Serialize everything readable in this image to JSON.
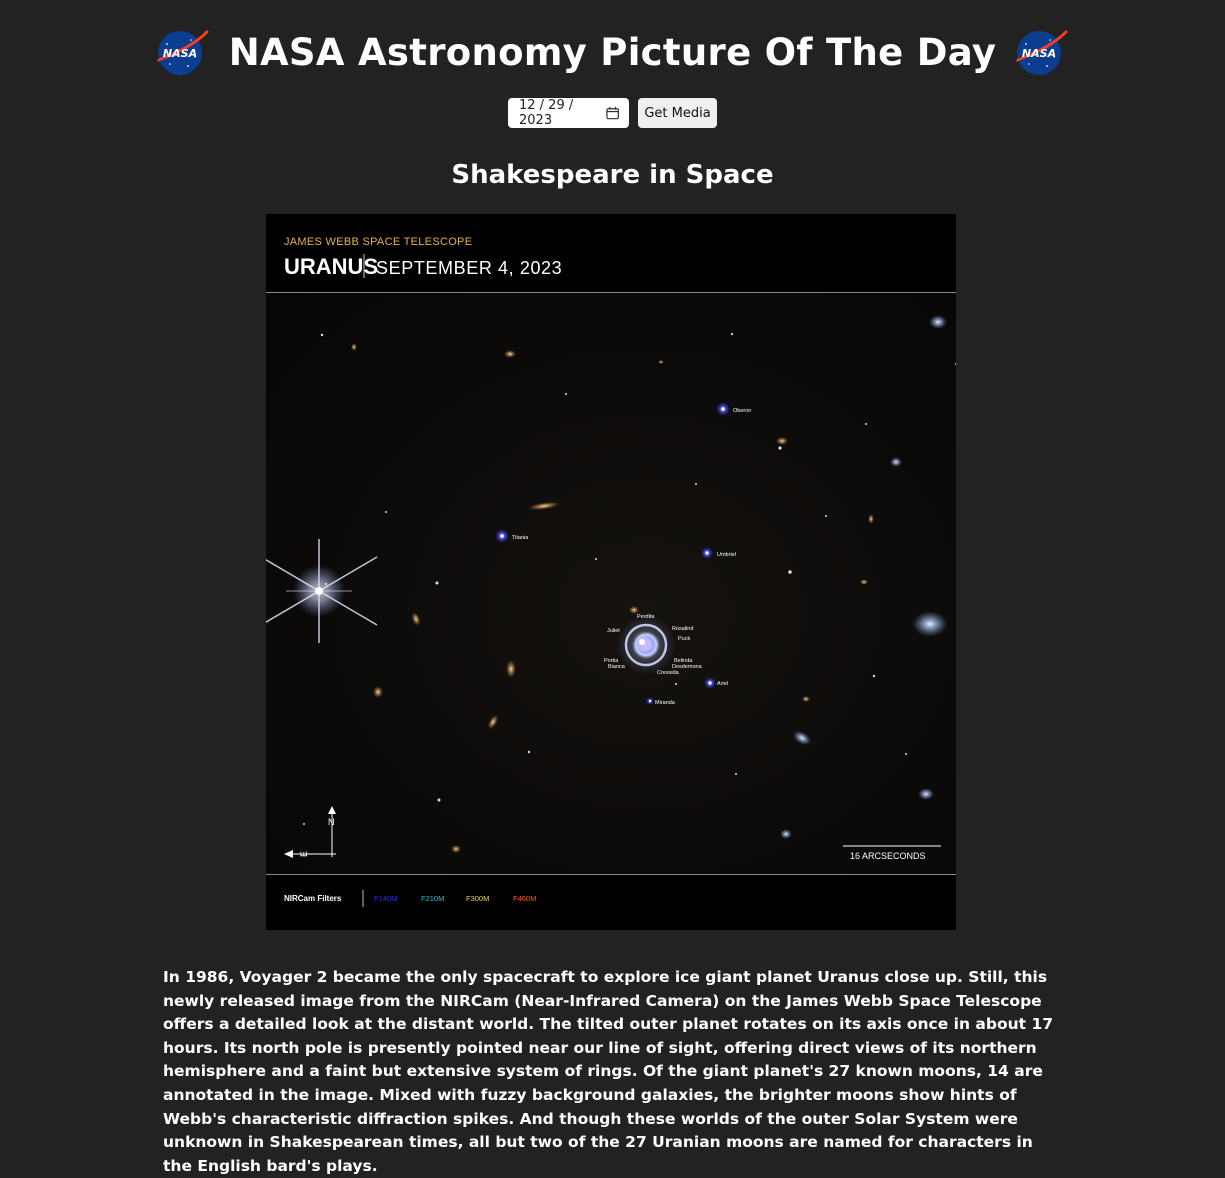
{
  "header": {
    "title": "NASA Astronomy Picture Of The Day",
    "logo_text": "NASA"
  },
  "controls": {
    "date_value": "12 / 29 / 2023",
    "get_media_label": "Get Media"
  },
  "apod": {
    "title": "Shakespeare in Space",
    "image": {
      "telescope": "JAMES WEBB SPACE TELESCOPE",
      "target": "URANUS",
      "date": "SEPTEMBER 4, 2023",
      "scale_label": "16 ARCSECONDS",
      "compass_n": "N",
      "compass_e": "E",
      "filters_label": "NIRCam Filters",
      "filters": [
        {
          "name": "F140M",
          "color": "#2b2bff"
        },
        {
          "name": "F210M",
          "color": "#22c4d4"
        },
        {
          "name": "F300M",
          "color": "#e8d84a"
        },
        {
          "name": "F460M",
          "color": "#ff5a2a"
        }
      ],
      "moons": {
        "oberon": "Oberon",
        "titania": "Titania",
        "umbriel": "Umbriel",
        "perdita": "Perdita",
        "rosalind": "Rosalind",
        "puck": "Puck",
        "juliet": "Juliet",
        "portia": "Portia",
        "bianca": "Bianca",
        "belinda": "Belinda",
        "desdemona": "Desdemona",
        "cressida": "Cressida",
        "ariel": "Ariel",
        "miranda": "Miranda"
      }
    },
    "explanation": "In 1986, Voyager 2 became the only spacecraft to explore ice giant planet Uranus close up. Still, this newly released image from the NIRCam (Near-Infrared Camera) on the James Webb Space Telescope offers a detailed look at the distant world. The tilted outer planet rotates on its axis once in about 17 hours. Its north pole is presently pointed near our line of sight, offering direct views of its northern hemisphere and a faint but extensive system of rings. Of the giant planet's 27 known moons, 14 are annotated in the image. Mixed with fuzzy background galaxies, the brighter moons show hints of Webb's characteristic diffraction spikes. And though these worlds of the outer Solar System were unknown in Shakespearean times, all but two of the 27 Uranian moons are named for characters in the English bard's plays."
  }
}
